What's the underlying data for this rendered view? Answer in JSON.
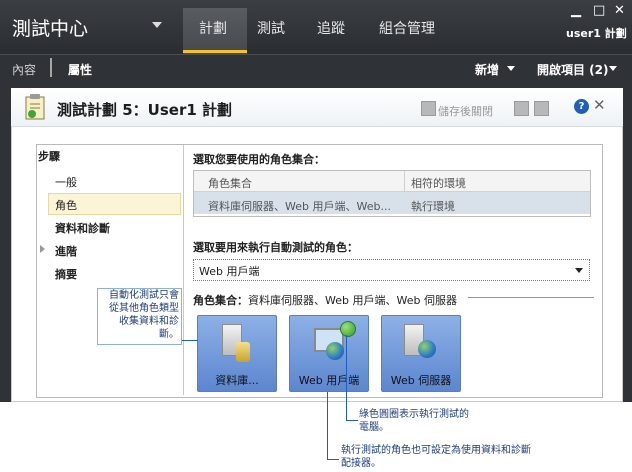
{
  "app": {
    "title": "測試中心",
    "tabs": [
      "計劃",
      "測試",
      "追蹤",
      "組合管理"
    ],
    "active_tab": "計劃",
    "user": "user1 計劃",
    "window_controls": {
      "minimize": "▁",
      "maximize": "□",
      "close": "✕"
    }
  },
  "subnav": {
    "items": [
      "內容",
      "屬性"
    ],
    "new_label": "新增",
    "open_items_label": "開啟項目 (2)"
  },
  "dialog": {
    "title": "測試計劃 5：User1 計劃",
    "save_close_label": "儲存後關閉",
    "help_label": "?",
    "close_label": "✕"
  },
  "steps": {
    "heading": "步驟",
    "items": [
      "一般",
      "角色",
      "資料和診斷",
      "進階",
      "摘要"
    ],
    "selected": "角色"
  },
  "role_sets": {
    "label": "選取您要使用的角色集合：",
    "columns": [
      "角色集合",
      "相符的環境"
    ],
    "rows": [
      [
        "資料庫伺服器、Web 用戶端、Web...",
        "執行環境"
      ]
    ]
  },
  "run_role": {
    "label": "選取要用來執行自動測試的角色：",
    "value": "Web 用戶端"
  },
  "role_set_summary": {
    "label": "角色集合：",
    "value": "資料庫伺服器、Web 用戶端、Web 伺服器"
  },
  "tiles": [
    "資料庫...",
    "Web 用戶端",
    "Web 伺服器"
  ],
  "callouts": {
    "left": "自動化測試只會從其他角色類型收集資料和診斷。",
    "green": "綠色圓圈表示執行測試的電腦。",
    "bottom": "執行測試的角色也可設定為使用資料和診斷配接器。"
  },
  "colors": {
    "accent_underline": "#f1c232",
    "selected_row": "#d8e1ea",
    "tile": "#6f96d8",
    "callout": "#1f5fb9"
  }
}
